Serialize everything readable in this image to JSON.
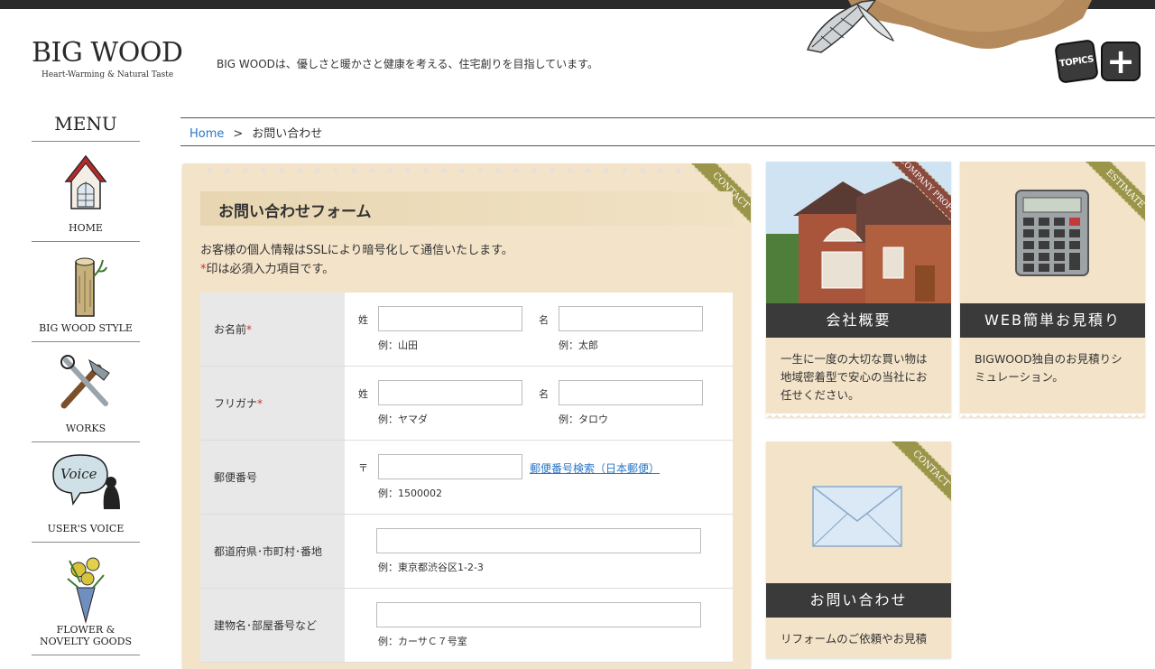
{
  "header": {
    "logo_main": "BIG WOOD",
    "logo_sub": "Heart-Warming & Natural Taste",
    "tagline": "BIG WOODは、優しさと暖かさと健康を考える、住宅創りを目指しています。",
    "topics_label": "TOPICS",
    "plus_label": "+"
  },
  "menu": {
    "title": "MENU",
    "items": [
      {
        "label": "HOME",
        "icon": "house-icon"
      },
      {
        "label": "BIG WOOD STYLE",
        "icon": "log-icon"
      },
      {
        "label": "WORKS",
        "icon": "tools-icon"
      },
      {
        "label": "USER'S VOICE",
        "icon": "voice-bubble-icon"
      },
      {
        "label": "FLOWER & NOVELTY GOODS",
        "icon": "bouquet-icon"
      }
    ]
  },
  "breadcrumb": {
    "home": "Home",
    "sep": ">",
    "current": "お問い合わせ"
  },
  "form": {
    "ribbon": "CONTACT",
    "title": "お問い合わせフォーム",
    "intro1": "お客様の個人情報はSSLにより暗号化して通信いたします。",
    "intro2_mark": "*",
    "intro2": "印は必須入力項目です。",
    "rows": {
      "name": {
        "label": "お名前",
        "req": "*",
        "sei": "姓",
        "mei": "名",
        "ex_sei": "例：山田",
        "ex_mei": "例：太郎"
      },
      "kana": {
        "label": "フリガナ",
        "req": "*",
        "sei": "姓",
        "mei": "名",
        "ex_sei": "例：ヤマダ",
        "ex_mei": "例：タロウ"
      },
      "zip": {
        "label": "郵便番号",
        "mark": "〒",
        "link": "郵便番号検索（日本郵便）",
        "ex": "例：1500002"
      },
      "addr": {
        "label": "都道府県･市町村･番地",
        "ex": "例：東京都渋谷区1-2-3"
      },
      "bldg": {
        "label": "建物名･部屋番号など",
        "ex": "例：カーサＣ７号室"
      }
    }
  },
  "cards": {
    "company": {
      "ribbon": "COMPANY PROFILE",
      "band": "会社概要",
      "text": "一生に一度の大切な買い物は地域密着型で安心の当社にお任せください。"
    },
    "estimate": {
      "ribbon": "ESTIMATE",
      "band": "WEB簡単お見積り",
      "text": "BIGWOOD独自のお見積りシミュレーション。"
    },
    "contact": {
      "ribbon": "CONTACT",
      "band": "お問い合わせ",
      "text": "リフォームのご依頼やお見積"
    }
  },
  "colors": {
    "link": "#2a76c6",
    "panel": "#f3e3c8",
    "ribbon": "#9a9548",
    "ribbon_red": "#8a4a3e",
    "band": "#3a3a3a",
    "required": "#cc3333"
  }
}
